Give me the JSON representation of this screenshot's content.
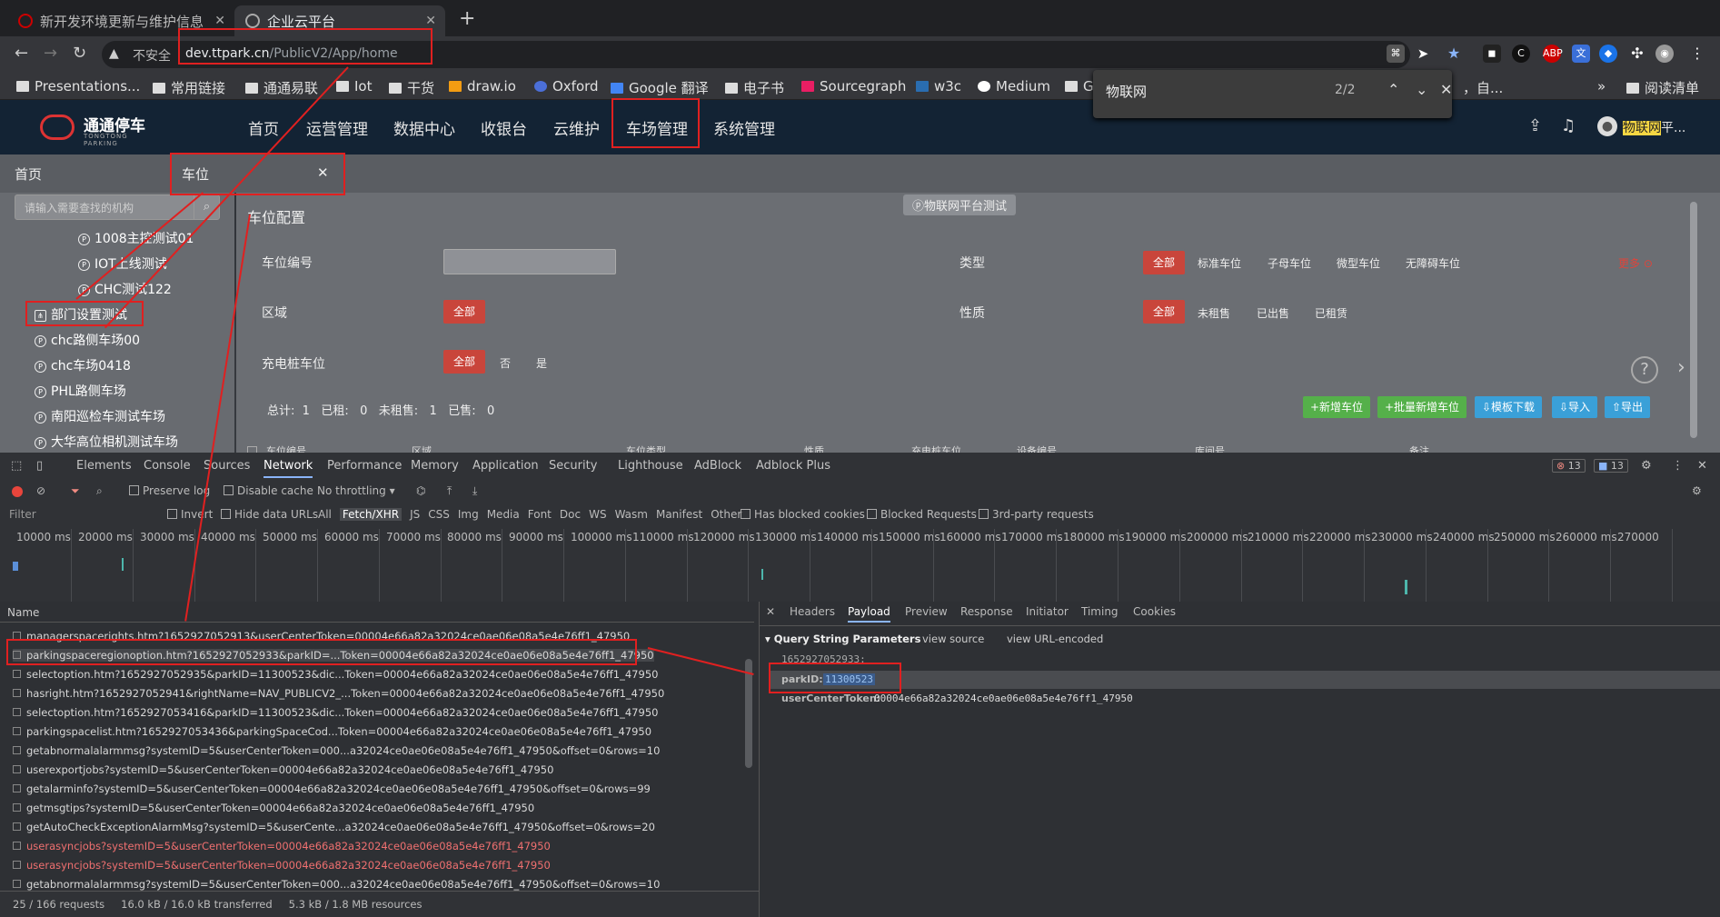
{
  "browser": {
    "tabs": [
      {
        "title": "新开发环境更新与维护信息"
      },
      {
        "title": "企业云平台"
      }
    ],
    "url_host": "dev.ttpark.cn",
    "url_path": "/PublicV2/App/home",
    "not_secure": "不安全",
    "bookmarks": [
      "Presentations...",
      "常用链接",
      "通通易联",
      "Iot",
      "干货",
      "draw.io",
      "Oxford",
      "Google 翻译",
      "电子书",
      "Sourcegraph",
      "w3c",
      "Medium",
      "G"
    ],
    "reading_list": "阅读清单",
    "bookmark_overflow": "，自...",
    "overflow": "»"
  },
  "findbar": {
    "query": "物联网",
    "count": "2/2"
  },
  "app": {
    "logo": "通通停车",
    "logo_sub": "TONGTONG PARKING",
    "nav": [
      "首页",
      "运营管理",
      "数据中心",
      "收银台",
      "云维护",
      "车场管理",
      "系统管理"
    ],
    "user_highlight": "物联网",
    "user_rest": "平..."
  },
  "pagetabs": {
    "home": "首页",
    "current": "车位"
  },
  "sidebar": {
    "search_placeholder": "请输入需要查找的机构",
    "items": [
      "1008主控测试01",
      "IOT上线测试",
      "CHC测试122",
      "部门设置测试",
      "chc路侧车场00",
      "chc车场0418",
      "PHL路侧车场",
      "南阳巡检车测试车场",
      "大华高位相机测试车场"
    ]
  },
  "content": {
    "title": "车位配置",
    "tag": "ⓟ物联网平台测试",
    "labels": {
      "code": "车位编号",
      "type": "类型",
      "area": "区域",
      "nature": "性质",
      "charge": "充电桩车位"
    },
    "all": "全部",
    "type_options": [
      "标准车位",
      "子母车位",
      "微型车位",
      "无障碍车位"
    ],
    "more": "更多",
    "nature_options": [
      "未租售",
      "已出售",
      "已租赁"
    ],
    "charge_options": [
      "否",
      "是"
    ],
    "summary": "总计:  1   已租:   0   未租售:   1   已售:   0",
    "buttons": [
      "+新增车位",
      "+批量新增车位",
      "⇩模板下载",
      "⇩导入",
      "⇧导出"
    ],
    "table_cols": [
      "车位编号",
      "区域",
      "车位类型",
      "性质",
      "充电桩车位",
      "设备编号",
      "库间号",
      "备注"
    ]
  },
  "devtools": {
    "tabs": [
      "Elements",
      "Console",
      "Sources",
      "Network",
      "Performance",
      "Memory",
      "Application",
      "Security",
      "Lighthouse",
      "AdBlock",
      "Adblock Plus"
    ],
    "errors": "13",
    "messages": "13",
    "toolbar": {
      "preserve": "Preserve log",
      "disable_cache": "Disable cache",
      "throttle": "No throttling"
    },
    "filter": {
      "placeholder": "Filter",
      "invert": "Invert",
      "hide_data": "Hide data URLs",
      "types": [
        "All",
        "Fetch/XHR",
        "JS",
        "CSS",
        "Img",
        "Media",
        "Font",
        "Doc",
        "WS",
        "Wasm",
        "Manifest",
        "Other"
      ],
      "blocked_cookies": "Has blocked cookies",
      "blocked_req": "Blocked Requests",
      "third_party": "3rd-party requests"
    },
    "timeline": [
      "10000 ms",
      "20000 ms",
      "30000 ms",
      "40000 ms",
      "50000 ms",
      "60000 ms",
      "70000 ms",
      "80000 ms",
      "90000 ms",
      "100000 ms",
      "110000 ms",
      "120000 ms",
      "130000 ms",
      "140000 ms",
      "150000 ms",
      "160000 ms",
      "170000 ms",
      "180000 ms",
      "190000 ms",
      "200000 ms",
      "210000 ms",
      "220000 ms",
      "230000 ms",
      "240000 ms",
      "250000 ms",
      "260000 ms",
      "270000"
    ],
    "name_col": "Name",
    "requests": [
      {
        "name": "managerspacerights.htm?1652927052913&userCenterToken=00004e66a82a32024ce0ae06e08a5e4e76ff1_47950",
        "err": false
      },
      {
        "name": "parkingspaceregionoption.htm?1652927052933&parkID=...Token=00004e66a82a32024ce0ae06e08a5e4e76ff1_47950",
        "err": false
      },
      {
        "name": "selectoption.htm?1652927052935&parkID=11300523&dic...Token=00004e66a82a32024ce0ae06e08a5e4e76ff1_47950",
        "err": false
      },
      {
        "name": "hasright.htm?1652927052941&rightName=NAV_PUBLICV2_...Token=00004e66a82a32024ce0ae06e08a5e4e76ff1_47950",
        "err": false
      },
      {
        "name": "selectoption.htm?1652927053416&parkID=11300523&dic...Token=00004e66a82a32024ce0ae06e08a5e4e76ff1_47950",
        "err": false
      },
      {
        "name": "parkingspacelist.htm?1652927053436&parkingSpaceCod...Token=00004e66a82a32024ce0ae06e08a5e4e76ff1_47950",
        "err": false
      },
      {
        "name": "getabnormalalarmmsg?systemID=5&userCenterToken=000...a32024ce0ae06e08a5e4e76ff1_47950&offset=0&rows=10",
        "err": false
      },
      {
        "name": "userexportjobs?systemID=5&userCenterToken=00004e66a82a32024ce0ae06e08a5e4e76ff1_47950",
        "err": false
      },
      {
        "name": "getalarminfo?systemID=5&userCenterToken=00004e66a82a32024ce0ae06e08a5e4e76ff1_47950&offset=0&rows=99",
        "err": false
      },
      {
        "name": "getmsgtips?systemID=5&userCenterToken=00004e66a82a32024ce0ae06e08a5e4e76ff1_47950",
        "err": false
      },
      {
        "name": "getAutoCheckExceptionAlarmMsg?systemID=5&userCente...a32024ce0ae06e08a5e4e76ff1_47950&offset=0&rows=20",
        "err": false
      },
      {
        "name": "userasyncjobs?systemID=5&userCenterToken=00004e66a82a32024ce0ae06e08a5e4e76ff1_47950",
        "err": true
      },
      {
        "name": "userasyncjobs?systemID=5&userCenterToken=00004e66a82a32024ce0ae06e08a5e4e76ff1_47950",
        "err": true
      },
      {
        "name": "getabnormalalarmmsg?systemID=5&userCenterToken=000...a32024ce0ae06e08a5e4e76ff1_47950&offset=0&rows=10",
        "err": false
      }
    ],
    "status": {
      "requests": "25 / 166 requests",
      "transferred": "16.0 kB / 16.0 kB transferred",
      "resources": "5.3 kB / 1.8 MB resources"
    },
    "detail_tabs": [
      "Headers",
      "Payload",
      "Preview",
      "Response",
      "Initiator",
      "Timing",
      "Cookies"
    ],
    "payload": {
      "section": "Query String Parameters",
      "view_source": "view source",
      "view_encoded": "view URL-encoded",
      "p0": "1652927052933:",
      "park_key": "parkID:",
      "park_val": "11300523",
      "token_key": "userCenterToken:",
      "token_val": "00004e66a82a32024ce0ae06e08a5e4e76ff1_47950"
    }
  }
}
